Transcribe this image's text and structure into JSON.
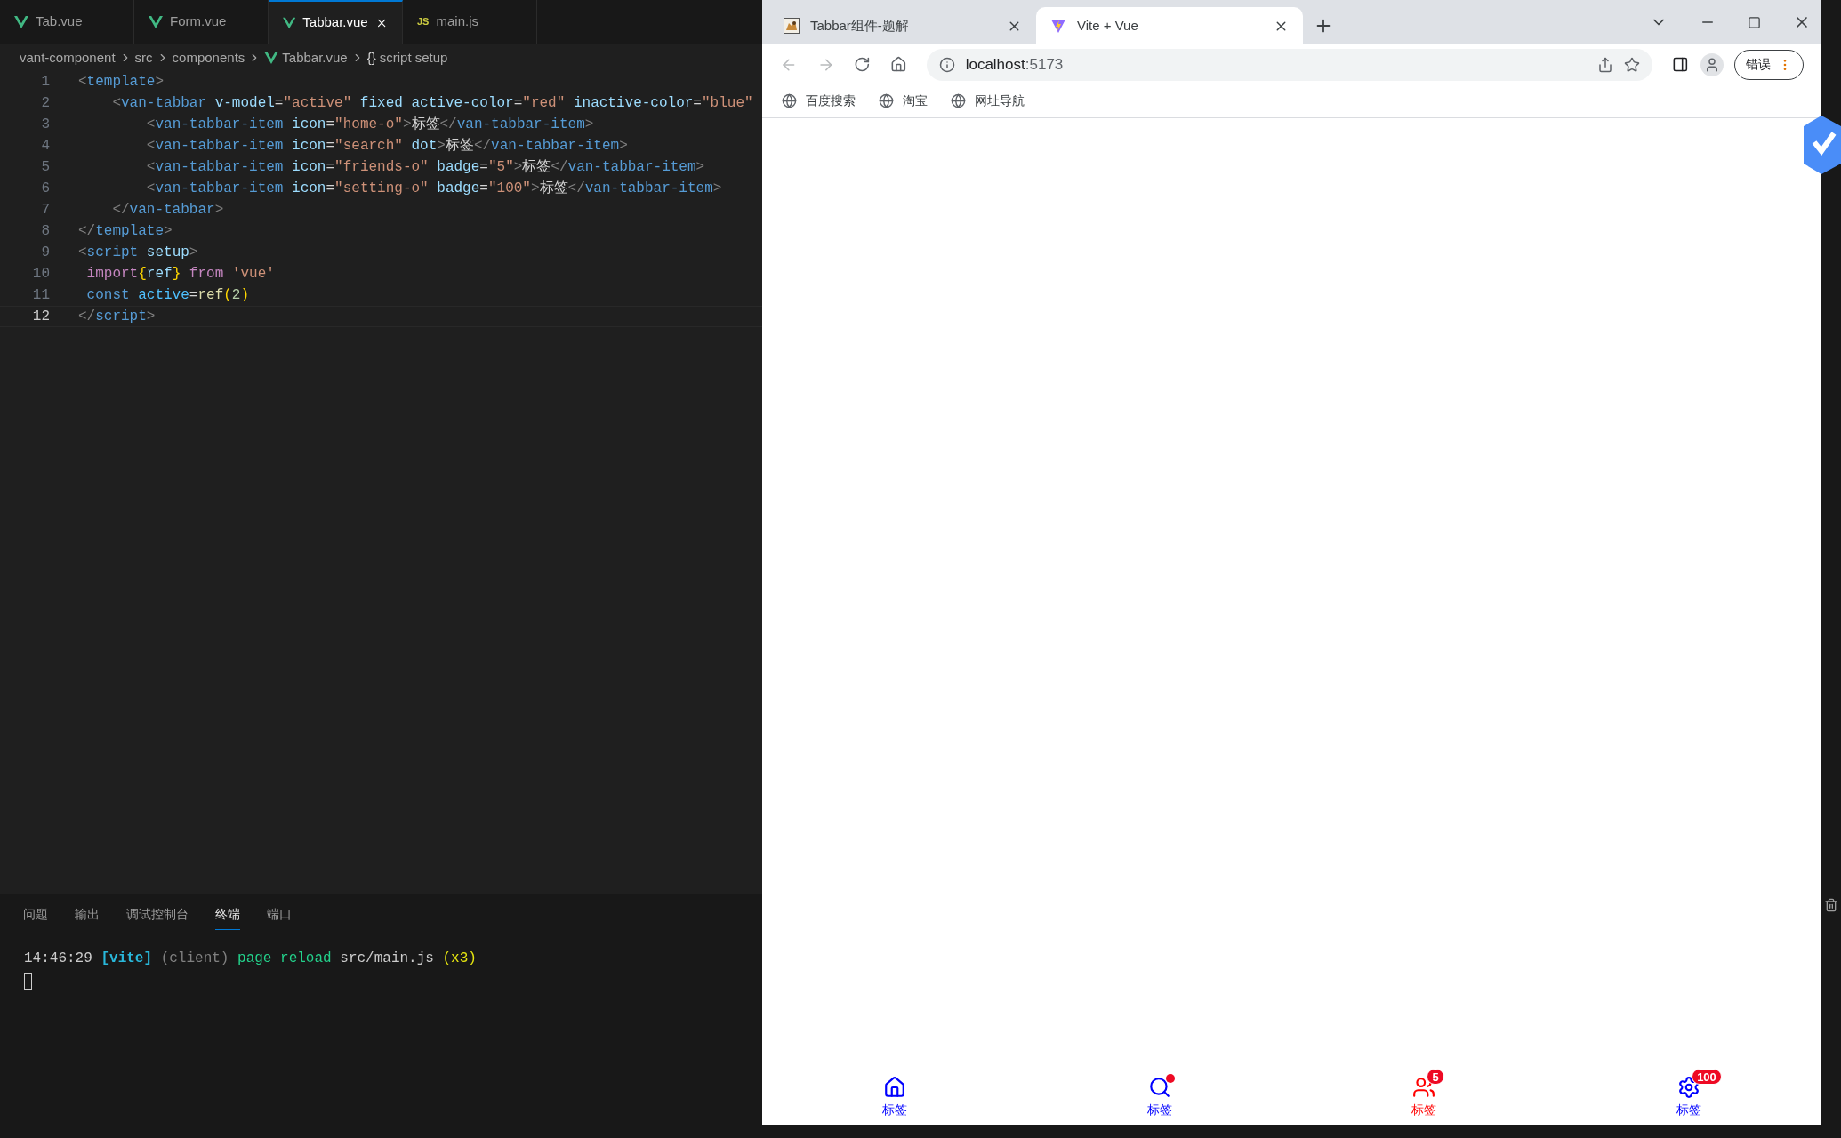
{
  "editor": {
    "tabs": [
      {
        "label": "Tab.vue",
        "kind": "vue",
        "selected": false
      },
      {
        "label": "Form.vue",
        "kind": "vue",
        "selected": false
      },
      {
        "label": "Tabbar.vue",
        "kind": "vue",
        "selected": true
      },
      {
        "label": "main.js",
        "kind": "js",
        "badge": "JS",
        "selected": false
      }
    ],
    "breadcrumb": [
      {
        "label": "vant-component",
        "kind": "plain"
      },
      {
        "label": "src",
        "kind": "plain"
      },
      {
        "label": "components",
        "kind": "plain"
      },
      {
        "label": "Tabbar.vue",
        "kind": "vue"
      },
      {
        "label": "script setup",
        "kind": "symbol",
        "symbol": "{}"
      }
    ],
    "lines": [
      {
        "number": "1",
        "current": false,
        "tokens": [
          {
            "text": "<",
            "kind": "punct"
          },
          {
            "text": "template",
            "kind": "tag"
          },
          {
            "text": ">",
            "kind": "punct"
          }
        ]
      },
      {
        "number": "2",
        "current": false,
        "tokens": [
          {
            "text": "    <",
            "kind": "punct"
          },
          {
            "text": "van-tabbar",
            "kind": "tag"
          },
          {
            "text": " v-model",
            "kind": "attr"
          },
          {
            "text": "=",
            "kind": "plain"
          },
          {
            "text": "\"active\"",
            "kind": "string"
          },
          {
            "text": " fixed active-color",
            "kind": "attr"
          },
          {
            "text": "=",
            "kind": "plain"
          },
          {
            "text": "\"red\"",
            "kind": "string"
          },
          {
            "text": " inactive-color",
            "kind": "attr"
          },
          {
            "text": "=",
            "kind": "plain"
          },
          {
            "text": "\"blue\"",
            "kind": "string"
          }
        ]
      },
      {
        "number": "3",
        "current": false,
        "tokens": [
          {
            "text": "        <",
            "kind": "punct"
          },
          {
            "text": "van-tabbar-item",
            "kind": "tag"
          },
          {
            "text": " icon",
            "kind": "attr"
          },
          {
            "text": "=",
            "kind": "plain"
          },
          {
            "text": "\"home-o\"",
            "kind": "string"
          },
          {
            "text": ">",
            "kind": "punct"
          },
          {
            "text": "标签",
            "kind": "plain"
          },
          {
            "text": "</",
            "kind": "punct"
          },
          {
            "text": "van-tabbar-item",
            "kind": "tag"
          },
          {
            "text": ">",
            "kind": "punct"
          }
        ]
      },
      {
        "number": "4",
        "current": false,
        "tokens": [
          {
            "text": "        <",
            "kind": "punct"
          },
          {
            "text": "van-tabbar-item",
            "kind": "tag"
          },
          {
            "text": " icon",
            "kind": "attr"
          },
          {
            "text": "=",
            "kind": "plain"
          },
          {
            "text": "\"search\"",
            "kind": "string"
          },
          {
            "text": " dot",
            "kind": "attr"
          },
          {
            "text": ">",
            "kind": "punct"
          },
          {
            "text": "标签",
            "kind": "plain"
          },
          {
            "text": "</",
            "kind": "punct"
          },
          {
            "text": "van-tabbar-item",
            "kind": "tag"
          },
          {
            "text": ">",
            "kind": "punct"
          }
        ]
      },
      {
        "number": "5",
        "current": false,
        "tokens": [
          {
            "text": "        <",
            "kind": "punct"
          },
          {
            "text": "van-tabbar-item",
            "kind": "tag"
          },
          {
            "text": " icon",
            "kind": "attr"
          },
          {
            "text": "=",
            "kind": "plain"
          },
          {
            "text": "\"friends-o\"",
            "kind": "string"
          },
          {
            "text": " badge",
            "kind": "attr"
          },
          {
            "text": "=",
            "kind": "plain"
          },
          {
            "text": "\"5\"",
            "kind": "string"
          },
          {
            "text": ">",
            "kind": "punct"
          },
          {
            "text": "标签",
            "kind": "plain"
          },
          {
            "text": "</",
            "kind": "punct"
          },
          {
            "text": "van-tabbar-item",
            "kind": "tag"
          },
          {
            "text": ">",
            "kind": "punct"
          }
        ]
      },
      {
        "number": "6",
        "current": false,
        "tokens": [
          {
            "text": "        <",
            "kind": "punct"
          },
          {
            "text": "van-tabbar-item",
            "kind": "tag"
          },
          {
            "text": " icon",
            "kind": "attr"
          },
          {
            "text": "=",
            "kind": "plain"
          },
          {
            "text": "\"setting-o\"",
            "kind": "string"
          },
          {
            "text": " badge",
            "kind": "attr"
          },
          {
            "text": "=",
            "kind": "plain"
          },
          {
            "text": "\"100\"",
            "kind": "string"
          },
          {
            "text": ">",
            "kind": "punct"
          },
          {
            "text": "标签",
            "kind": "plain"
          },
          {
            "text": "</",
            "kind": "punct"
          },
          {
            "text": "van-tabbar-item",
            "kind": "tag"
          },
          {
            "text": ">",
            "kind": "punct"
          }
        ]
      },
      {
        "number": "7",
        "current": false,
        "tokens": [
          {
            "text": "    </",
            "kind": "punct"
          },
          {
            "text": "van-tabbar",
            "kind": "tag"
          },
          {
            "text": ">",
            "kind": "punct"
          }
        ]
      },
      {
        "number": "8",
        "current": false,
        "tokens": [
          {
            "text": "</",
            "kind": "punct"
          },
          {
            "text": "template",
            "kind": "tag"
          },
          {
            "text": ">",
            "kind": "punct"
          }
        ]
      },
      {
        "number": "9",
        "current": false,
        "tokens": [
          {
            "text": "<",
            "kind": "punct"
          },
          {
            "text": "script",
            "kind": "tag"
          },
          {
            "text": " setup",
            "kind": "attr"
          },
          {
            "text": ">",
            "kind": "punct"
          }
        ]
      },
      {
        "number": "10",
        "current": false,
        "tokens": [
          {
            "text": " import",
            "kind": "keyword"
          },
          {
            "text": "{",
            "kind": "bracket"
          },
          {
            "text": "ref",
            "kind": "var"
          },
          {
            "text": "}",
            "kind": "bracket"
          },
          {
            "text": " from ",
            "kind": "keyword"
          },
          {
            "text": "'vue'",
            "kind": "string"
          }
        ]
      },
      {
        "number": "11",
        "current": false,
        "tokens": [
          {
            "text": " const",
            "kind": "storage"
          },
          {
            "text": " active",
            "kind": "const"
          },
          {
            "text": "=",
            "kind": "plain"
          },
          {
            "text": "ref",
            "kind": "func"
          },
          {
            "text": "(",
            "kind": "bracket"
          },
          {
            "text": "2",
            "kind": "number"
          },
          {
            "text": ")",
            "kind": "bracket"
          }
        ]
      },
      {
        "number": "12",
        "current": true,
        "tokens": [
          {
            "text": "</",
            "kind": "punct"
          },
          {
            "text": "script",
            "kind": "tag"
          },
          {
            "text": ">",
            "kind": "punct"
          }
        ]
      }
    ]
  },
  "panel": {
    "tabs": [
      {
        "label": "问题",
        "selected": false
      },
      {
        "label": "输出",
        "selected": false
      },
      {
        "label": "调试控制台",
        "selected": false
      },
      {
        "label": "终端",
        "selected": true
      },
      {
        "label": "端口",
        "selected": false
      }
    ],
    "terminal": [
      {
        "text": "14:46:29 ",
        "kind": "plain"
      },
      {
        "text": "[vite]",
        "kind": "vite"
      },
      {
        "text": " (client)",
        "kind": "dim"
      },
      {
        "text": " page reload",
        "kind": "green"
      },
      {
        "text": " src/main.js",
        "kind": "plain"
      },
      {
        "text": " (x3)",
        "kind": "yellow"
      }
    ]
  },
  "browser": {
    "tabs": [
      {
        "title": "Tabbar组件-题解",
        "kind": "picture",
        "selected": false
      },
      {
        "title": "Vite + Vue",
        "kind": "vite",
        "selected": true
      }
    ],
    "address": {
      "host": "localhost",
      "port": ":5173"
    },
    "profile_button": "错误",
    "bookmarks": [
      "百度搜索",
      "淘宝",
      "网址导航"
    ],
    "tabbar": [
      {
        "label": "标签",
        "kind": "home",
        "selected": false
      },
      {
        "label": "标签",
        "kind": "search",
        "dot": true,
        "selected": false
      },
      {
        "label": "标签",
        "kind": "friends",
        "badge": "5",
        "selected": true
      },
      {
        "label": "标签",
        "kind": "setting",
        "badge": "100",
        "selected": false
      }
    ]
  }
}
